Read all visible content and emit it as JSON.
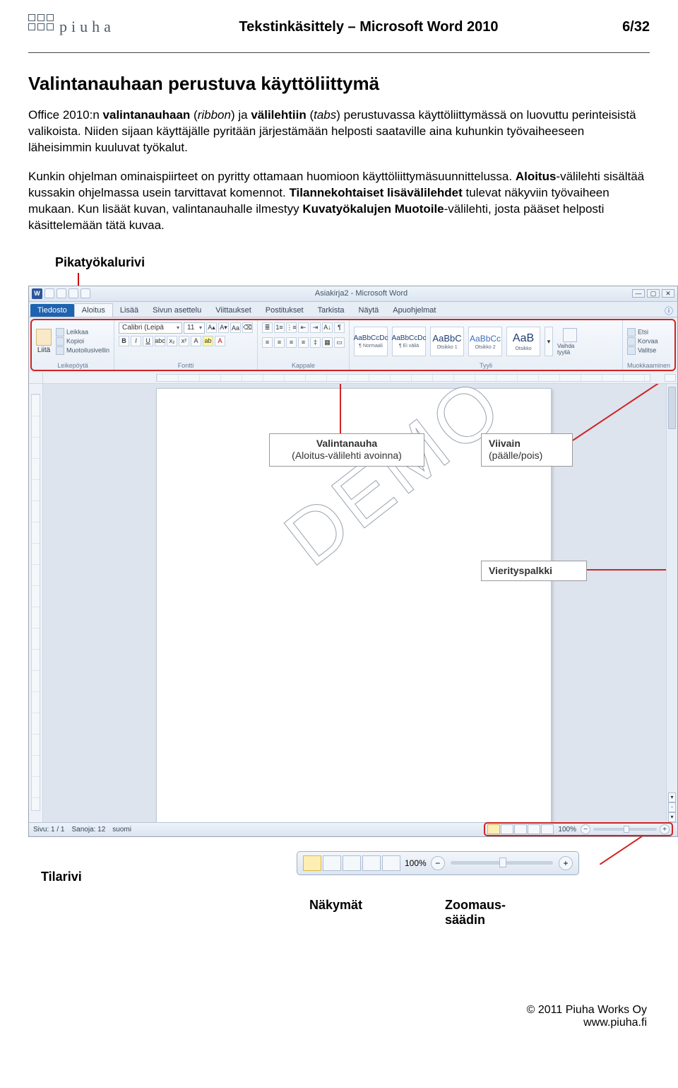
{
  "header": {
    "logo_text": "piuha",
    "title": "Tekstinkäsittely – Microsoft Word 2010",
    "page": "6/32"
  },
  "section_title": "Valintanauhaan perustuva käyttöliittymä",
  "para1_a": "Office 2010:n ",
  "para1_b": "valintanauhaan",
  "para1_c": " (",
  "para1_d": "ribbon",
  "para1_e": ") ja ",
  "para1_f": "välilehtiin",
  "para1_g": " (",
  "para1_h": "tabs",
  "para1_i": ") perustuvassa käyttöliittymässä on luovuttu perinteisistä valikoista. Niiden sijaan käyttäjälle pyritään järjestämään helposti saataville aina kuhunkin työvaiheeseen läheisimmin kuuluvat työkalut.",
  "para2_a": "Kunkin ohjelman ominaispiirteet on pyritty ottamaan huomioon käyttöliittymäsuunnittelussa. ",
  "para2_b": "Aloitus",
  "para2_c": "-välilehti sisältää kussakin ohjelmassa usein tarvittavat komennot. ",
  "para2_d": "Tilannekohtaiset lisävälilehdet",
  "para2_e": " tulevat näkyviin työvaiheen mukaan. Kun lisäät kuvan, valintanauhalle ilmestyy ",
  "para2_f": "Kuvatyökalujen Muotoile",
  "para2_g": "-välilehti, josta pääset helposti käsittelemään tätä kuvaa.",
  "labels": {
    "pika": "Pikatyökalurivi",
    "valintanauha_t": "Valintanauha",
    "valintanauha_s": "(Aloitus-välilehti avoinna)",
    "viivain_t": "Viivain",
    "viivain_s": "(päälle/pois)",
    "vieritys": "Vierityspalkki",
    "tilarivi": "Tilarivi",
    "nakymat": "Näkymät",
    "zoom": "Zoomaus-\nsäädin"
  },
  "word": {
    "app_title": "Asiakirja2 - Microsoft Word",
    "file_tab": "Tiedosto",
    "tabs": [
      "Aloitus",
      "Lisää",
      "Sivun asettelu",
      "Viittaukset",
      "Postitukset",
      "Tarkista",
      "Näytä",
      "Apuohjelmat"
    ],
    "groups": {
      "leike": "Leikepöytä",
      "fontti": "Fontti",
      "kappale": "Kappale",
      "tyyli": "Tyyli",
      "muok": "Muokkaaminen"
    },
    "paste": "Liitä",
    "clip": {
      "leikkaa": "Leikkaa",
      "kopioi": "Kopioi",
      "sivellin": "Muotoilusivellin"
    },
    "font_name": "Calibri (Leipä",
    "font_size": "11",
    "styles": [
      {
        "samp": "AaBbCcDc",
        "name": "¶ Normaali"
      },
      {
        "samp": "AaBbCcDc",
        "name": "¶ Ei väliä"
      },
      {
        "samp": "AaBbC",
        "name": "Otsikko 1"
      },
      {
        "samp": "AaBbCc",
        "name": "Otsikko 2"
      },
      {
        "samp": "AaB",
        "name": "Otsikko"
      }
    ],
    "change_styles": "Vaihda tyyliä",
    "edit": {
      "etsi": "Etsi",
      "korvaa": "Korvaa",
      "valitse": "Valitse"
    },
    "status": {
      "sivu": "Sivu: 1 / 1",
      "sanoja": "Sanoja: 12",
      "kieli": "suomi",
      "zoom": "100%"
    },
    "zoomed_zoom": "100%"
  },
  "footer": {
    "line1": "© 2011 Piuha Works Oy",
    "line2": "www.piuha.fi"
  },
  "demo": "DEMO"
}
